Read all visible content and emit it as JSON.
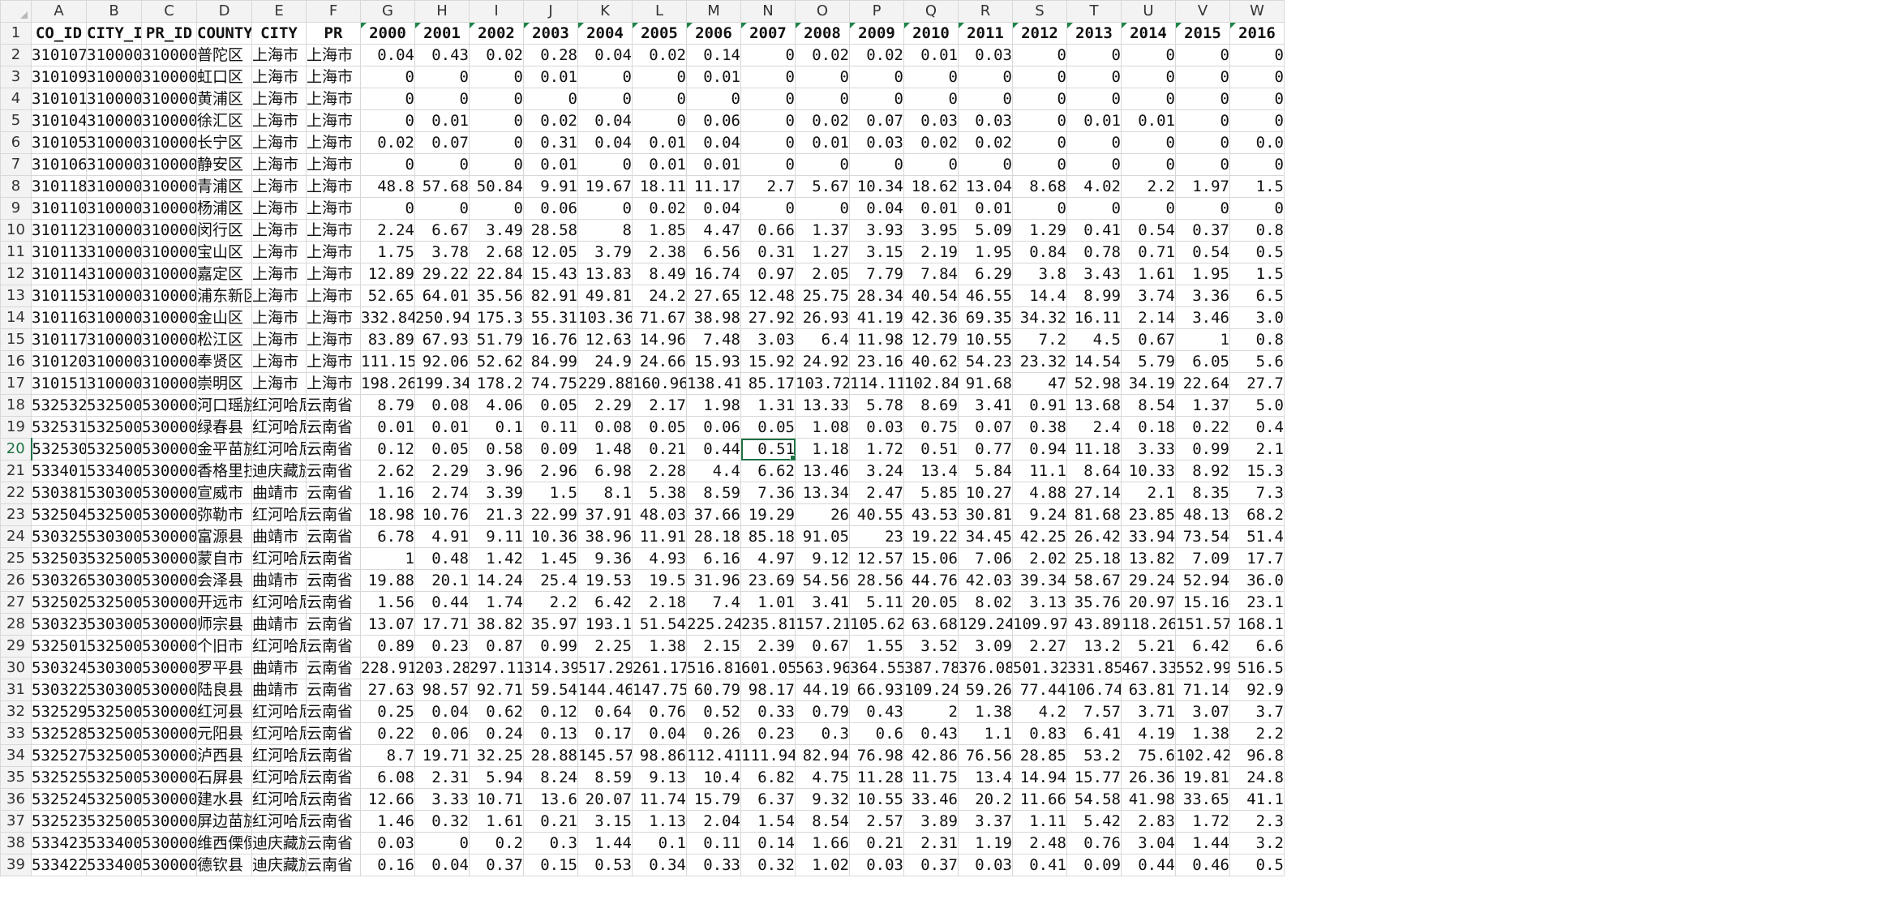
{
  "sheet": {
    "column_letters": [
      "A",
      "B",
      "C",
      "D",
      "E",
      "F",
      "G",
      "H",
      "I",
      "J",
      "K",
      "L",
      "M",
      "N",
      "O",
      "P",
      "Q",
      "R",
      "S",
      "T",
      "U",
      "V",
      "W"
    ],
    "selected_column": "N",
    "selected_row": 20,
    "active_cell": "N20",
    "accent_color": "#1e7145",
    "header": [
      "CO_ID",
      "CITY_ID",
      "PR_ID",
      "COUNTY",
      "CITY",
      "PR",
      "2000",
      "2001",
      "2002",
      "2003",
      "2004",
      "2005",
      "2006",
      "2007",
      "2008",
      "2009",
      "2010",
      "2011",
      "2012",
      "2013",
      "2014",
      "2015",
      "2016"
    ],
    "rows": [
      [
        "310107",
        "310000",
        "310000",
        "普陀区",
        "上海市",
        "上海市",
        "0.04",
        "0.43",
        "0.02",
        "0.28",
        "0.04",
        "0.02",
        "0.14",
        "0",
        "0.02",
        "0.02",
        "0.01",
        "0.03",
        "0",
        "0",
        "0",
        "0",
        "0"
      ],
      [
        "310109",
        "310000",
        "310000",
        "虹口区",
        "上海市",
        "上海市",
        "0",
        "0",
        "0",
        "0.01",
        "0",
        "0",
        "0.01",
        "0",
        "0",
        "0",
        "0",
        "0",
        "0",
        "0",
        "0",
        "0",
        "0"
      ],
      [
        "310101",
        "310000",
        "310000",
        "黄浦区",
        "上海市",
        "上海市",
        "0",
        "0",
        "0",
        "0",
        "0",
        "0",
        "0",
        "0",
        "0",
        "0",
        "0",
        "0",
        "0",
        "0",
        "0",
        "0",
        "0"
      ],
      [
        "310104",
        "310000",
        "310000",
        "徐汇区",
        "上海市",
        "上海市",
        "0",
        "0.01",
        "0",
        "0.02",
        "0.04",
        "0",
        "0.06",
        "0",
        "0.02",
        "0.07",
        "0.03",
        "0.03",
        "0",
        "0.01",
        "0.01",
        "0",
        "0"
      ],
      [
        "310105",
        "310000",
        "310000",
        "长宁区",
        "上海市",
        "上海市",
        "0.02",
        "0.07",
        "0",
        "0.31",
        "0.04",
        "0.01",
        "0.04",
        "0",
        "0.01",
        "0.03",
        "0.02",
        "0.02",
        "0",
        "0",
        "0",
        "0",
        "0.0"
      ],
      [
        "310106",
        "310000",
        "310000",
        "静安区",
        "上海市",
        "上海市",
        "0",
        "0",
        "0",
        "0.01",
        "0",
        "0.01",
        "0.01",
        "0",
        "0",
        "0",
        "0",
        "0",
        "0",
        "0",
        "0",
        "0",
        "0"
      ],
      [
        "310118",
        "310000",
        "310000",
        "青浦区",
        "上海市",
        "上海市",
        "48.8",
        "57.68",
        "50.84",
        "9.91",
        "19.67",
        "18.11",
        "11.17",
        "2.7",
        "5.67",
        "10.34",
        "18.62",
        "13.04",
        "8.68",
        "4.02",
        "2.2",
        "1.97",
        "1.5"
      ],
      [
        "310110",
        "310000",
        "310000",
        "杨浦区",
        "上海市",
        "上海市",
        "0",
        "0",
        "0",
        "0.06",
        "0",
        "0.02",
        "0.04",
        "0",
        "0",
        "0.04",
        "0.01",
        "0.01",
        "0",
        "0",
        "0",
        "0",
        "0"
      ],
      [
        "310112",
        "310000",
        "310000",
        "闵行区",
        "上海市",
        "上海市",
        "2.24",
        "6.67",
        "3.49",
        "28.58",
        "8",
        "1.85",
        "4.47",
        "0.66",
        "1.37",
        "3.93",
        "3.95",
        "5.09",
        "1.29",
        "0.41",
        "0.54",
        "0.37",
        "0.8"
      ],
      [
        "310113",
        "310000",
        "310000",
        "宝山区",
        "上海市",
        "上海市",
        "1.75",
        "3.78",
        "2.68",
        "12.05",
        "3.79",
        "2.38",
        "6.56",
        "0.31",
        "1.27",
        "3.15",
        "2.19",
        "1.95",
        "0.84",
        "0.78",
        "0.71",
        "0.54",
        "0.5"
      ],
      [
        "310114",
        "310000",
        "310000",
        "嘉定区",
        "上海市",
        "上海市",
        "12.89",
        "29.22",
        "22.84",
        "15.43",
        "13.83",
        "8.49",
        "16.74",
        "0.97",
        "2.05",
        "7.79",
        "7.84",
        "6.29",
        "3.8",
        "3.43",
        "1.61",
        "1.95",
        "1.5"
      ],
      [
        "310115",
        "310000",
        "310000",
        "浦东新区",
        "上海市",
        "上海市",
        "52.65",
        "64.01",
        "35.56",
        "82.91",
        "49.81",
        "24.2",
        "27.65",
        "12.48",
        "25.75",
        "28.34",
        "40.54",
        "46.55",
        "14.4",
        "8.99",
        "3.74",
        "3.36",
        "6.5"
      ],
      [
        "310116",
        "310000",
        "310000",
        "金山区",
        "上海市",
        "上海市",
        "332.84",
        "250.94",
        "175.3",
        "55.31",
        "103.36",
        "71.67",
        "38.98",
        "27.92",
        "26.93",
        "41.19",
        "42.36",
        "69.35",
        "34.32",
        "16.11",
        "2.14",
        "3.46",
        "3.0"
      ],
      [
        "310117",
        "310000",
        "310000",
        "松江区",
        "上海市",
        "上海市",
        "83.89",
        "67.93",
        "51.79",
        "16.76",
        "12.63",
        "14.96",
        "7.48",
        "3.03",
        "6.4",
        "11.98",
        "12.79",
        "10.55",
        "7.2",
        "4.5",
        "0.67",
        "1",
        "0.8"
      ],
      [
        "310120",
        "310000",
        "310000",
        "奉贤区",
        "上海市",
        "上海市",
        "111.15",
        "92.06",
        "52.62",
        "84.99",
        "24.9",
        "24.66",
        "15.93",
        "15.92",
        "24.92",
        "23.16",
        "40.62",
        "54.23",
        "23.32",
        "14.54",
        "5.79",
        "6.05",
        "5.6"
      ],
      [
        "310151",
        "310000",
        "310000",
        "崇明区",
        "上海市",
        "上海市",
        "198.26",
        "199.34",
        "178.2",
        "74.75",
        "229.88",
        "160.96",
        "138.41",
        "85.17",
        "103.72",
        "114.11",
        "102.84",
        "91.68",
        "47",
        "52.98",
        "34.19",
        "22.64",
        "27.7"
      ],
      [
        "532532",
        "532500",
        "530000",
        "河口瑶族",
        "红河哈尼",
        "云南省",
        "8.79",
        "0.08",
        "4.06",
        "0.05",
        "2.29",
        "2.17",
        "1.98",
        "1.31",
        "13.33",
        "5.78",
        "8.69",
        "3.41",
        "0.91",
        "13.68",
        "8.54",
        "1.37",
        "5.0"
      ],
      [
        "532531",
        "532500",
        "530000",
        "绿春县",
        "红河哈尼",
        "云南省",
        "0.01",
        "0.01",
        "0.1",
        "0.11",
        "0.08",
        "0.05",
        "0.06",
        "0.05",
        "1.08",
        "0.03",
        "0.75",
        "0.07",
        "0.38",
        "2.4",
        "0.18",
        "0.22",
        "0.4"
      ],
      [
        "532530",
        "532500",
        "530000",
        "金平苗族",
        "红河哈尼",
        "云南省",
        "0.12",
        "0.05",
        "0.58",
        "0.09",
        "1.48",
        "0.21",
        "0.44",
        "0.51",
        "1.18",
        "1.72",
        "0.51",
        "0.77",
        "0.94",
        "11.18",
        "3.33",
        "0.99",
        "2.1"
      ],
      [
        "533401",
        "533400",
        "530000",
        "香格里拉",
        "迪庆藏族",
        "云南省",
        "2.62",
        "2.29",
        "3.96",
        "2.96",
        "6.98",
        "2.28",
        "4.4",
        "6.62",
        "13.46",
        "3.24",
        "13.4",
        "5.84",
        "11.1",
        "8.64",
        "10.33",
        "8.92",
        "15.3"
      ],
      [
        "530381",
        "530300",
        "530000",
        "宣威市",
        "曲靖市",
        "云南省",
        "1.16",
        "2.74",
        "3.39",
        "1.5",
        "8.1",
        "5.38",
        "8.59",
        "7.36",
        "13.34",
        "2.47",
        "5.85",
        "10.27",
        "4.88",
        "27.14",
        "2.1",
        "8.35",
        "7.3"
      ],
      [
        "532504",
        "532500",
        "530000",
        "弥勒市",
        "红河哈尼",
        "云南省",
        "18.98",
        "10.76",
        "21.3",
        "22.99",
        "37.91",
        "48.03",
        "37.66",
        "19.29",
        "26",
        "40.55",
        "43.53",
        "30.81",
        "9.24",
        "81.68",
        "23.85",
        "48.13",
        "68.2"
      ],
      [
        "530325",
        "530300",
        "530000",
        "富源县",
        "曲靖市",
        "云南省",
        "6.78",
        "4.91",
        "9.11",
        "10.36",
        "38.96",
        "11.91",
        "28.18",
        "85.18",
        "91.05",
        "23",
        "19.22",
        "34.45",
        "42.25",
        "26.42",
        "33.94",
        "73.54",
        "51.4"
      ],
      [
        "532503",
        "532500",
        "530000",
        "蒙自市",
        "红河哈尼",
        "云南省",
        "1",
        "0.48",
        "1.42",
        "1.45",
        "9.36",
        "4.93",
        "6.16",
        "4.97",
        "9.12",
        "12.57",
        "15.06",
        "7.06",
        "2.02",
        "25.18",
        "13.82",
        "7.09",
        "17.7"
      ],
      [
        "530326",
        "530300",
        "530000",
        "会泽县",
        "曲靖市",
        "云南省",
        "19.88",
        "20.1",
        "14.24",
        "25.4",
        "19.53",
        "19.5",
        "31.96",
        "23.69",
        "54.56",
        "28.56",
        "44.76",
        "42.03",
        "39.34",
        "58.67",
        "29.24",
        "52.94",
        "36.0"
      ],
      [
        "532502",
        "532500",
        "530000",
        "开远市",
        "红河哈尼",
        "云南省",
        "1.56",
        "0.44",
        "1.74",
        "2.2",
        "6.42",
        "2.18",
        "7.4",
        "1.01",
        "3.41",
        "5.11",
        "20.05",
        "8.02",
        "3.13",
        "35.76",
        "20.97",
        "15.16",
        "23.1"
      ],
      [
        "530323",
        "530300",
        "530000",
        "师宗县",
        "曲靖市",
        "云南省",
        "13.07",
        "17.71",
        "38.82",
        "35.97",
        "193.1",
        "51.54",
        "225.24",
        "235.81",
        "157.21",
        "105.62",
        "63.68",
        "129.24",
        "109.97",
        "43.89",
        "118.26",
        "151.57",
        "168.1"
      ],
      [
        "532501",
        "532500",
        "530000",
        "个旧市",
        "红河哈尼",
        "云南省",
        "0.89",
        "0.23",
        "0.87",
        "0.99",
        "2.25",
        "1.38",
        "2.15",
        "2.39",
        "0.67",
        "1.55",
        "3.52",
        "3.09",
        "2.27",
        "13.2",
        "5.21",
        "6.42",
        "6.6"
      ],
      [
        "530324",
        "530300",
        "530000",
        "罗平县",
        "曲靖市",
        "云南省",
        "228.91",
        "203.28",
        "297.11",
        "314.39",
        "517.29",
        "261.17",
        "516.81",
        "601.05",
        "563.96",
        "364.55",
        "387.78",
        "376.08",
        "501.32",
        "331.85",
        "467.33",
        "552.99",
        "516.5"
      ],
      [
        "530322",
        "530300",
        "530000",
        "陆良县",
        "曲靖市",
        "云南省",
        "27.63",
        "98.57",
        "92.71",
        "59.54",
        "144.46",
        "147.75",
        "60.79",
        "98.17",
        "44.19",
        "66.93",
        "109.24",
        "59.26",
        "77.44",
        "106.74",
        "63.81",
        "71.14",
        "92.9"
      ],
      [
        "532529",
        "532500",
        "530000",
        "红河县",
        "红河哈尼",
        "云南省",
        "0.25",
        "0.04",
        "0.62",
        "0.12",
        "0.64",
        "0.76",
        "0.52",
        "0.33",
        "0.79",
        "0.43",
        "2",
        "1.38",
        "4.2",
        "7.57",
        "3.71",
        "3.07",
        "3.7"
      ],
      [
        "532528",
        "532500",
        "530000",
        "元阳县",
        "红河哈尼",
        "云南省",
        "0.22",
        "0.06",
        "0.24",
        "0.13",
        "0.17",
        "0.04",
        "0.26",
        "0.23",
        "0.3",
        "0.6",
        "0.43",
        "1.1",
        "0.83",
        "6.41",
        "4.19",
        "1.38",
        "2.2"
      ],
      [
        "532527",
        "532500",
        "530000",
        "泸西县",
        "红河哈尼",
        "云南省",
        "8.7",
        "19.71",
        "32.25",
        "28.88",
        "145.57",
        "98.86",
        "112.41",
        "111.94",
        "82.94",
        "76.98",
        "42.86",
        "76.56",
        "28.85",
        "53.2",
        "75.6",
        "102.42",
        "96.8"
      ],
      [
        "532525",
        "532500",
        "530000",
        "石屏县",
        "红河哈尼",
        "云南省",
        "6.08",
        "2.31",
        "5.94",
        "8.24",
        "8.59",
        "9.13",
        "10.4",
        "6.82",
        "4.75",
        "11.28",
        "11.75",
        "13.4",
        "14.94",
        "15.77",
        "26.36",
        "19.81",
        "24.8"
      ],
      [
        "532524",
        "532500",
        "530000",
        "建水县",
        "红河哈尼",
        "云南省",
        "12.66",
        "3.33",
        "10.71",
        "13.6",
        "20.07",
        "11.74",
        "15.79",
        "6.37",
        "9.32",
        "10.55",
        "33.46",
        "20.2",
        "11.66",
        "54.58",
        "41.98",
        "33.65",
        "41.1"
      ],
      [
        "532523",
        "532500",
        "530000",
        "屏边苗族",
        "红河哈尼",
        "云南省",
        "1.46",
        "0.32",
        "1.61",
        "0.21",
        "3.15",
        "1.13",
        "2.04",
        "1.54",
        "8.54",
        "2.57",
        "3.89",
        "3.37",
        "1.11",
        "5.42",
        "2.83",
        "1.72",
        "2.3"
      ],
      [
        "533423",
        "533400",
        "530000",
        "维西傈僳",
        "迪庆藏族",
        "云南省",
        "0.03",
        "0",
        "0.2",
        "0.3",
        "1.44",
        "0.1",
        "0.11",
        "0.14",
        "1.66",
        "0.21",
        "2.31",
        "1.19",
        "2.48",
        "0.76",
        "3.04",
        "1.44",
        "3.2"
      ],
      [
        "533422",
        "533400",
        "530000",
        "德钦县",
        "迪庆藏族",
        "云南省",
        "0.16",
        "0.04",
        "0.37",
        "0.15",
        "0.53",
        "0.34",
        "0.33",
        "0.32",
        "1.02",
        "0.03",
        "0.37",
        "0.03",
        "0.41",
        "0.09",
        "0.44",
        "0.46",
        "0.5"
      ]
    ]
  }
}
